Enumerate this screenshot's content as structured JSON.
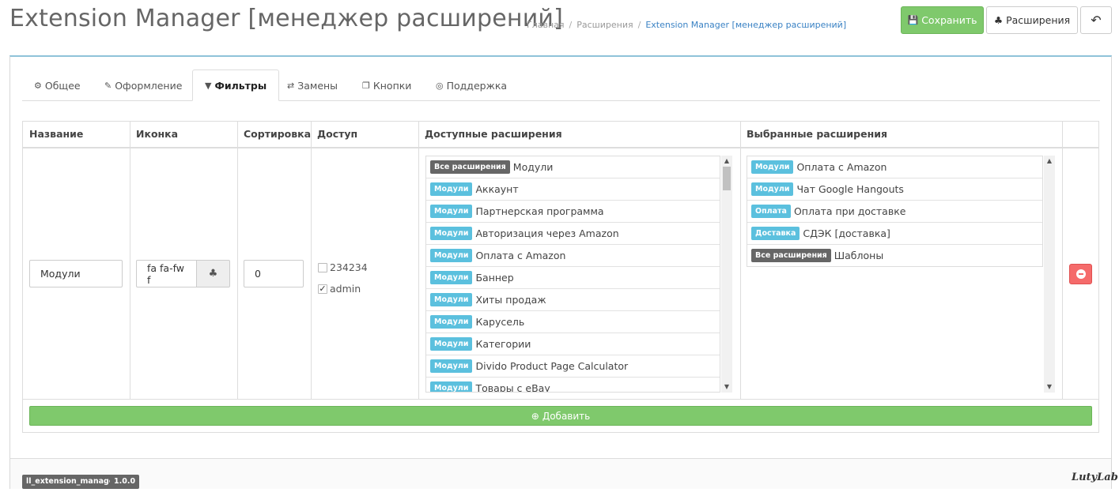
{
  "header": {
    "title": "Extension Manager [менеджер расширений]",
    "breadcrumb": [
      "Главная",
      "Расширения",
      "Extension Manager [менеджер расширений]"
    ],
    "save_label": "Сохранить",
    "extensions_label": "Расширения"
  },
  "tabs": [
    {
      "label": "Общее",
      "icon": "gear-icon"
    },
    {
      "label": "Оформление",
      "icon": "brush-icon"
    },
    {
      "label": "Фильтры",
      "icon": "filter-icon",
      "active": true
    },
    {
      "label": "Замены",
      "icon": "exchange-icon"
    },
    {
      "label": "Кнопки",
      "icon": "clone-icon"
    },
    {
      "label": "Поддержка",
      "icon": "life-ring-icon"
    }
  ],
  "table": {
    "headers": [
      "Название",
      "Иконка",
      "Сортировка",
      "Доступ",
      "Доступные расширения",
      "Выбранные расширения"
    ],
    "row": {
      "name_value": "Модули",
      "icon_value": "fa fa-fw f",
      "sort_value": "0",
      "access": [
        {
          "label": "234234",
          "checked": false
        },
        {
          "label": "admin",
          "checked": true
        }
      ]
    },
    "available": [
      {
        "badge": "Все расширения",
        "type": "grey",
        "label": "Модули"
      },
      {
        "badge": "Модули",
        "type": "blue",
        "label": "Аккаунт"
      },
      {
        "badge": "Модули",
        "type": "blue",
        "label": "Партнерская программа"
      },
      {
        "badge": "Модули",
        "type": "blue",
        "label": "Авторизация через Amazon"
      },
      {
        "badge": "Модули",
        "type": "blue",
        "label": "Оплата с Amazon"
      },
      {
        "badge": "Модули",
        "type": "blue",
        "label": "Баннер"
      },
      {
        "badge": "Модули",
        "type": "blue",
        "label": "Хиты продаж"
      },
      {
        "badge": "Модули",
        "type": "blue",
        "label": "Карусель"
      },
      {
        "badge": "Модули",
        "type": "blue",
        "label": "Категории"
      },
      {
        "badge": "Модули",
        "type": "blue",
        "label": "Divido Product Page Calculator"
      },
      {
        "badge": "Модули",
        "type": "blue",
        "label": "Товары с eBay"
      }
    ],
    "selected": [
      {
        "badge": "Модули",
        "type": "blue",
        "label": "Оплата с Amazon"
      },
      {
        "badge": "Модули",
        "type": "blue",
        "label": "Чат Google Hangouts"
      },
      {
        "badge": "Оплата",
        "type": "blue",
        "label": "Оплата при доставке"
      },
      {
        "badge": "Доставка",
        "type": "blue",
        "label": "СДЭК [доставка]"
      },
      {
        "badge": "Все расширения",
        "type": "grey",
        "label": "Шаблоны"
      }
    ],
    "add_label": "Добавить"
  },
  "footer": {
    "module_code": "ll_extension_manager",
    "version": "1.0.0",
    "logo_text": "LutyLab"
  }
}
